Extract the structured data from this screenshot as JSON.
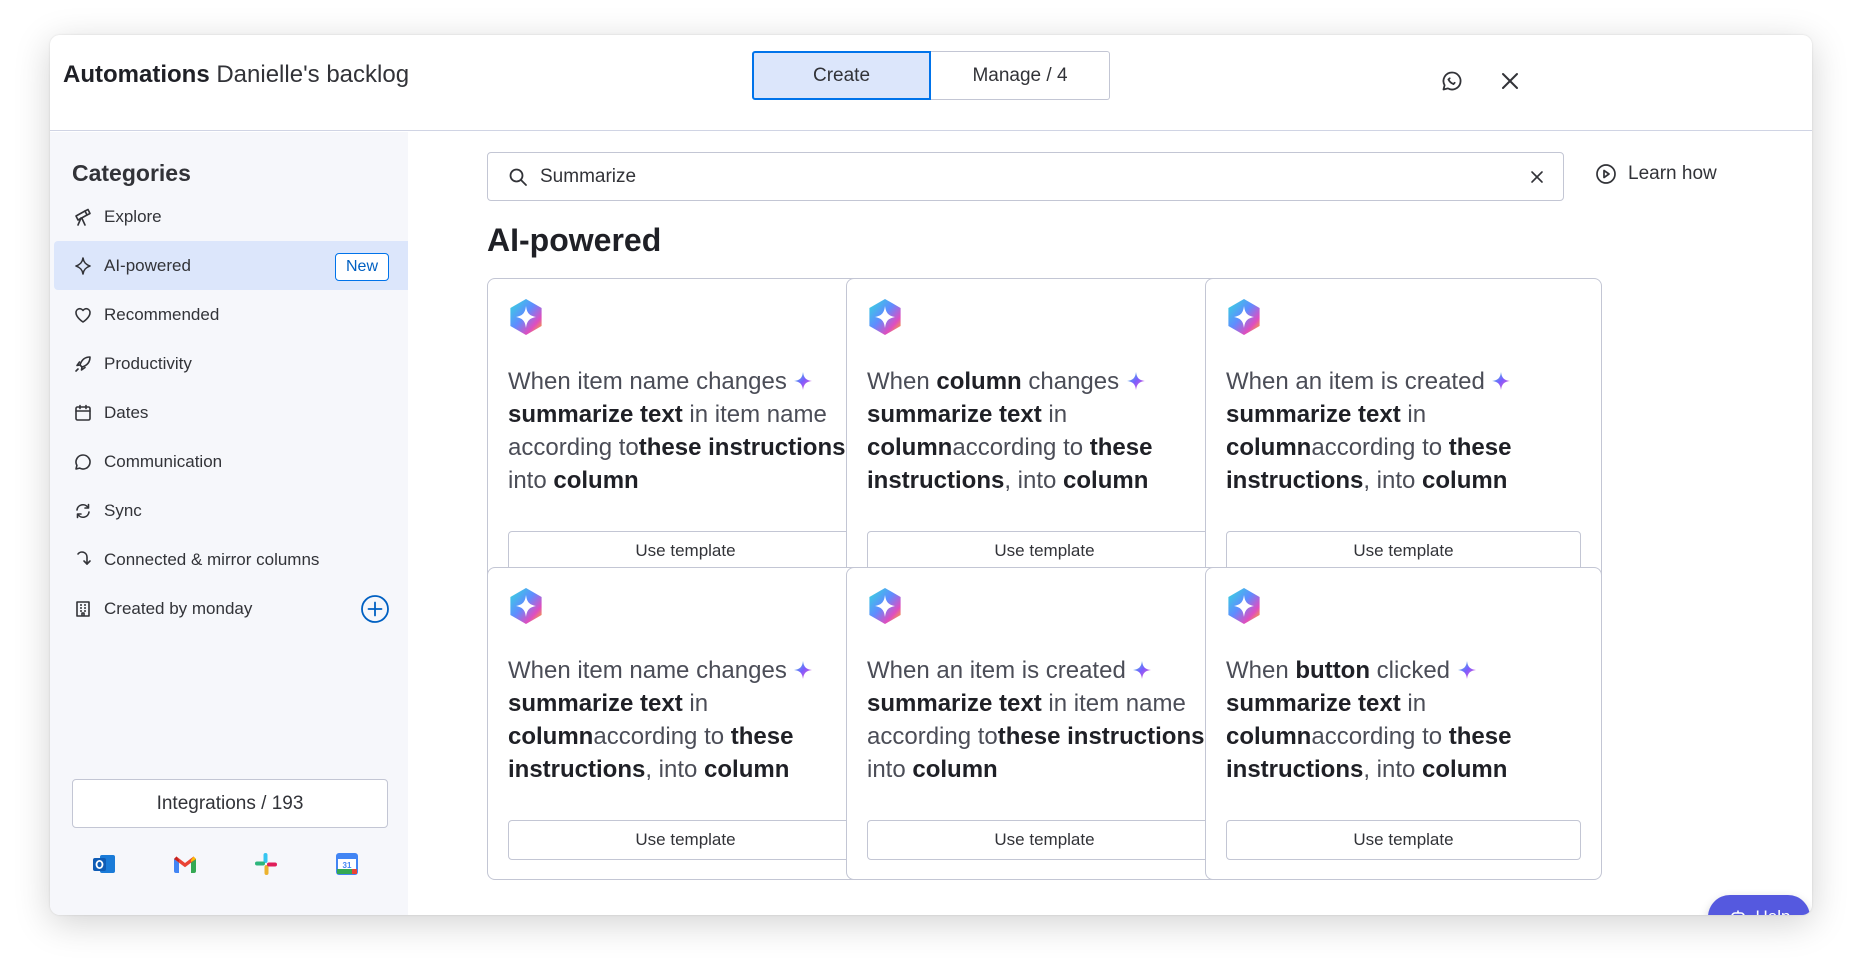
{
  "header": {
    "title_bold": "Automations",
    "title_board": "Danielle's backlog",
    "tabs": [
      {
        "label": "Create",
        "active": true
      },
      {
        "label": "Manage / 4",
        "active": false
      }
    ],
    "feedback_icon": "chat-bubble-icon",
    "close_icon": "close-icon"
  },
  "sidebar": {
    "title": "Categories",
    "items": [
      {
        "label": "Explore",
        "icon": "telescope-icon"
      },
      {
        "label": "AI-powered",
        "icon": "sparkle-icon",
        "badge": "New",
        "active": true
      },
      {
        "label": "Recommended",
        "icon": "heart-icon"
      },
      {
        "label": "Productivity",
        "icon": "rocket-icon"
      },
      {
        "label": "Dates",
        "icon": "calendar-icon"
      },
      {
        "label": "Communication",
        "icon": "speech-bubble-icon"
      },
      {
        "label": "Sync",
        "icon": "sync-icon"
      },
      {
        "label": "Connected & mirror columns",
        "icon": "connect-icon"
      },
      {
        "label": "Created by monday",
        "icon": "building-icon",
        "action_icon": "add-circle-icon"
      }
    ],
    "integrations_label": "Integrations / 193",
    "integration_apps": [
      "outlook-icon",
      "gmail-icon",
      "slack-icon",
      "google-calendar-icon"
    ]
  },
  "main": {
    "search": {
      "value": "Summarize",
      "placeholder": "Search"
    },
    "learn_how": "Learn how",
    "section_title": "AI-powered",
    "use_template_label": "Use template",
    "cards": [
      {
        "parts": [
          [
            "t",
            "When item name changes "
          ],
          [
            "s",
            ""
          ],
          [
            "b",
            "summarize text"
          ],
          [
            "t",
            " in item name according to"
          ],
          [
            "b",
            "these instructions"
          ],
          [
            "t",
            ", into "
          ],
          [
            "b",
            "column"
          ]
        ]
      },
      {
        "parts": [
          [
            "t",
            "When "
          ],
          [
            "b",
            "column"
          ],
          [
            "t",
            " changes "
          ],
          [
            "s",
            ""
          ],
          [
            "b",
            "summarize text"
          ],
          [
            "t",
            " in "
          ],
          [
            "b",
            "column"
          ],
          [
            "t",
            "according to "
          ],
          [
            "b",
            "these instructions"
          ],
          [
            "t",
            ", into "
          ],
          [
            "b",
            "column"
          ]
        ]
      },
      {
        "parts": [
          [
            "t",
            "When an item is created "
          ],
          [
            "s",
            ""
          ],
          [
            "b",
            "summarize text"
          ],
          [
            "t",
            " in "
          ],
          [
            "b",
            "column"
          ],
          [
            "t",
            "according to "
          ],
          [
            "b",
            "these instructions"
          ],
          [
            "t",
            ", into "
          ],
          [
            "b",
            "column"
          ]
        ]
      },
      {
        "parts": [
          [
            "t",
            "When item name changes "
          ],
          [
            "s",
            ""
          ],
          [
            "b",
            "summarize text"
          ],
          [
            "t",
            " in "
          ],
          [
            "b",
            "column"
          ],
          [
            "t",
            "according to "
          ],
          [
            "b",
            "these instructions"
          ],
          [
            "t",
            ", into "
          ],
          [
            "b",
            "column"
          ]
        ]
      },
      {
        "parts": [
          [
            "t",
            "When an item is created "
          ],
          [
            "s",
            ""
          ],
          [
            "b",
            "summarize text"
          ],
          [
            "t",
            " in item name according to"
          ],
          [
            "b",
            "these instructions"
          ],
          [
            "t",
            ", into "
          ],
          [
            "b",
            "column"
          ]
        ]
      },
      {
        "parts": [
          [
            "t",
            "When "
          ],
          [
            "b",
            "button"
          ],
          [
            "t",
            " clicked "
          ],
          [
            "s",
            ""
          ],
          [
            "b",
            "summarize text"
          ],
          [
            "t",
            " in "
          ],
          [
            "b",
            "column"
          ],
          [
            "t",
            "according to "
          ],
          [
            "b",
            "these instructions"
          ],
          [
            "t",
            ", into "
          ],
          [
            "b",
            "column"
          ]
        ]
      }
    ]
  },
  "help": {
    "label": "Help",
    "icon": "robot-icon"
  },
  "colors": {
    "accent": "#0073ea",
    "accent_bg": "#dce6fb",
    "help_bg": "#5559df",
    "sidebar_bg": "#f6f7fb"
  }
}
